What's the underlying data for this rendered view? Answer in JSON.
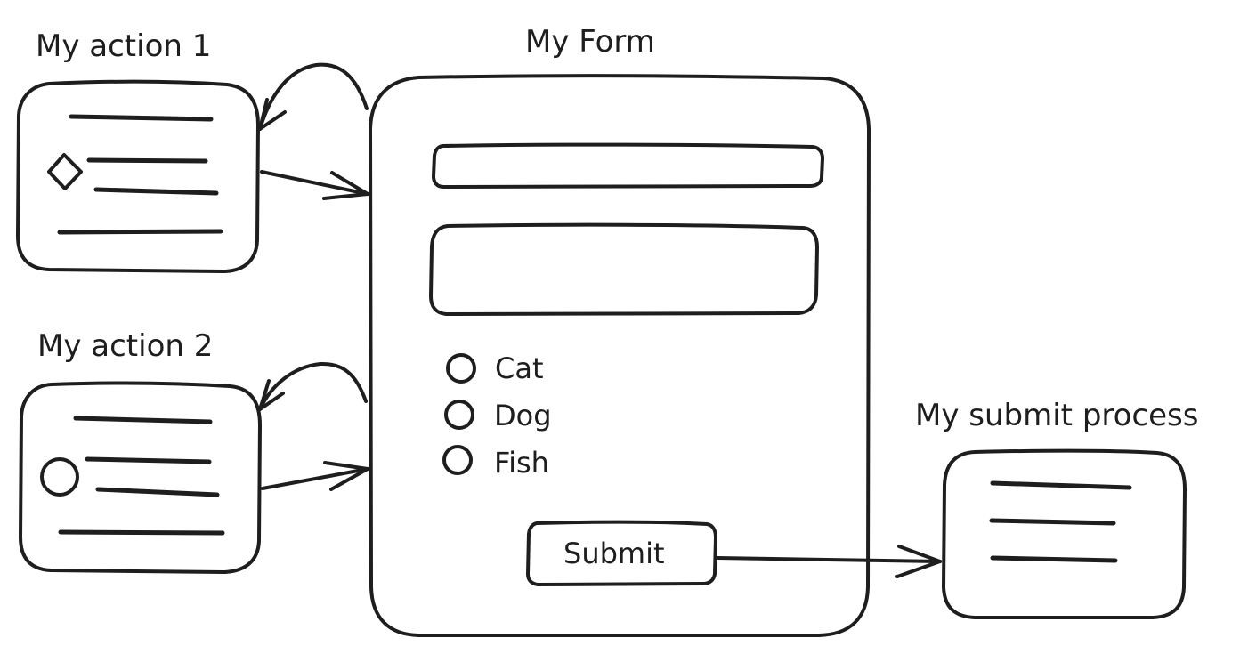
{
  "diagram": {
    "title": "My Form",
    "nodes": {
      "action1": {
        "label": "My action 1"
      },
      "action2": {
        "label": "My action 2"
      },
      "submit_process": {
        "label": "My submit process"
      }
    },
    "form": {
      "options": [
        "Cat",
        "Dog",
        "Fish"
      ],
      "submit_label": "Submit"
    },
    "colors": {
      "stroke": "#1e1e1e",
      "background": "#ffffff"
    }
  }
}
